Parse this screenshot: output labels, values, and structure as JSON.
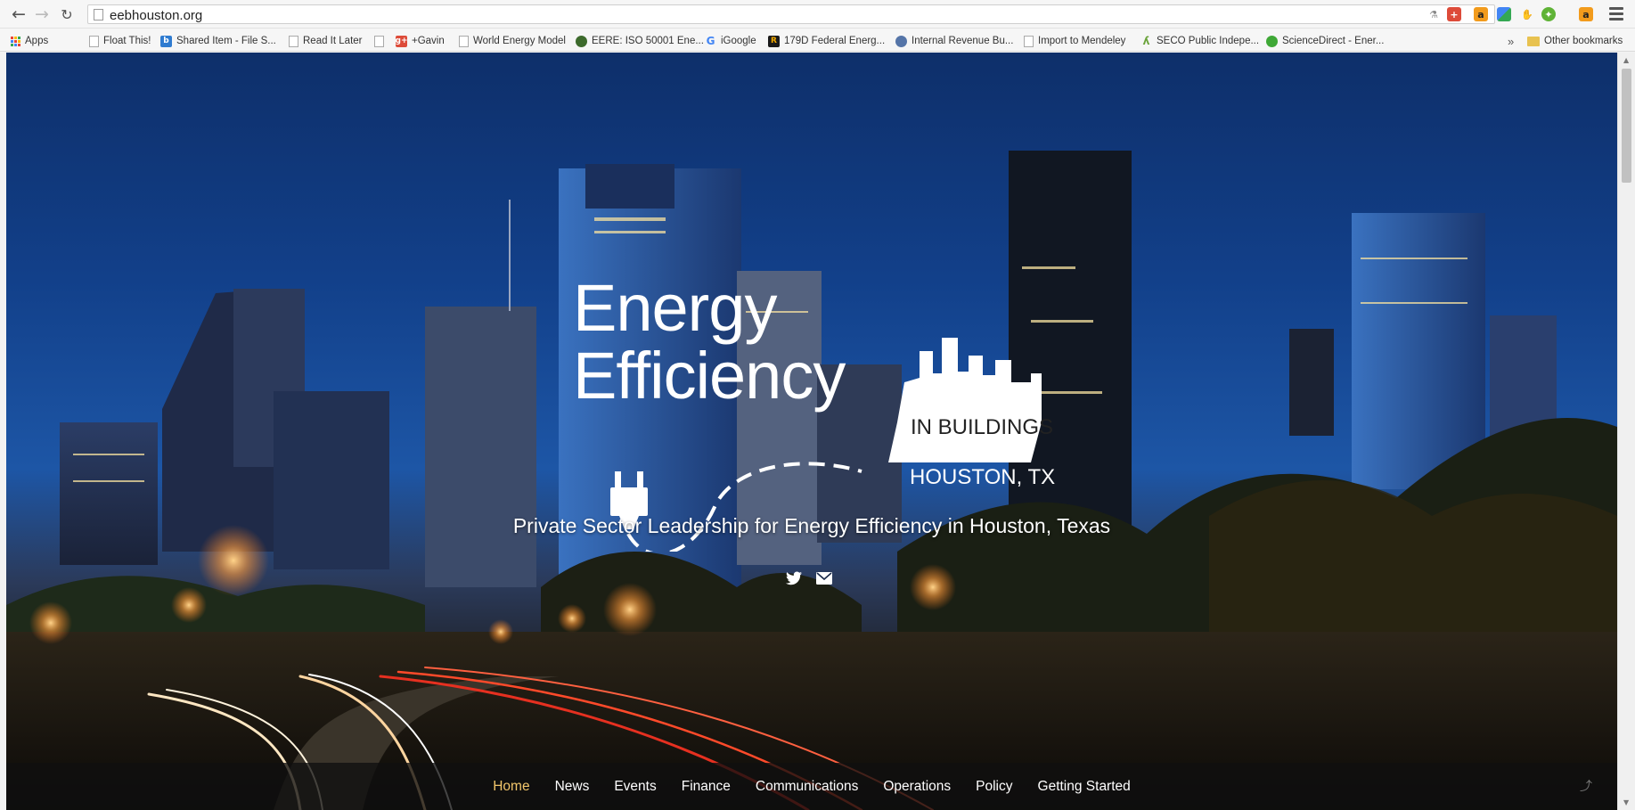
{
  "browser": {
    "url": "eebhouston.org",
    "bookmarks": [
      {
        "label": "Apps",
        "icon": "apps-grid-icon"
      },
      {
        "label": "Float This!",
        "icon": "page-icon"
      },
      {
        "label": "Shared Item - File S...",
        "icon": "box-icon"
      },
      {
        "label": "Read It Later",
        "icon": "page-icon"
      },
      {
        "label": "",
        "icon": "page-icon"
      },
      {
        "label": "+Gavin",
        "icon": "google-plus-icon"
      },
      {
        "label": "World Energy Model",
        "icon": "page-icon"
      },
      {
        "label": "EERE: ISO 50001 Ene...",
        "icon": "doe-seal-icon"
      },
      {
        "label": "iGoogle",
        "icon": "google-icon"
      },
      {
        "label": "179D Federal Energ...",
        "icon": "r-icon"
      },
      {
        "label": "Internal Revenue Bu...",
        "icon": "irs-icon"
      },
      {
        "label": "Import to Mendeley",
        "icon": "page-icon"
      },
      {
        "label": "SECO Public Indepe...",
        "icon": "seco-icon"
      },
      {
        "label": "ScienceDirect - Ener...",
        "icon": "green-circle-icon"
      }
    ],
    "overflow_label": "»",
    "other_bookmarks": "Other bookmarks",
    "colors": {
      "google_red": "#dd4b39",
      "amazon_orange": "#f29b1c",
      "evernote_green": "#5fb336"
    }
  },
  "site": {
    "logo": {
      "line1": "Energy",
      "line2": "Efficiency",
      "badge": "IN BUILDINGS",
      "location": "HOUSTON, TX"
    },
    "tagline": "Private Sector Leadership for Energy Efficiency in Houston, Texas",
    "social": [
      {
        "name": "twitter-icon"
      },
      {
        "name": "email-icon"
      }
    ],
    "nav": [
      {
        "label": "Home",
        "active": true
      },
      {
        "label": "News",
        "active": false
      },
      {
        "label": "Events",
        "active": false
      },
      {
        "label": "Finance",
        "active": false
      },
      {
        "label": "Communications",
        "active": false
      },
      {
        "label": "Operations",
        "active": false
      },
      {
        "label": "Policy",
        "active": false
      },
      {
        "label": "Getting Started",
        "active": false
      }
    ],
    "active_color": "#f2c66b"
  }
}
